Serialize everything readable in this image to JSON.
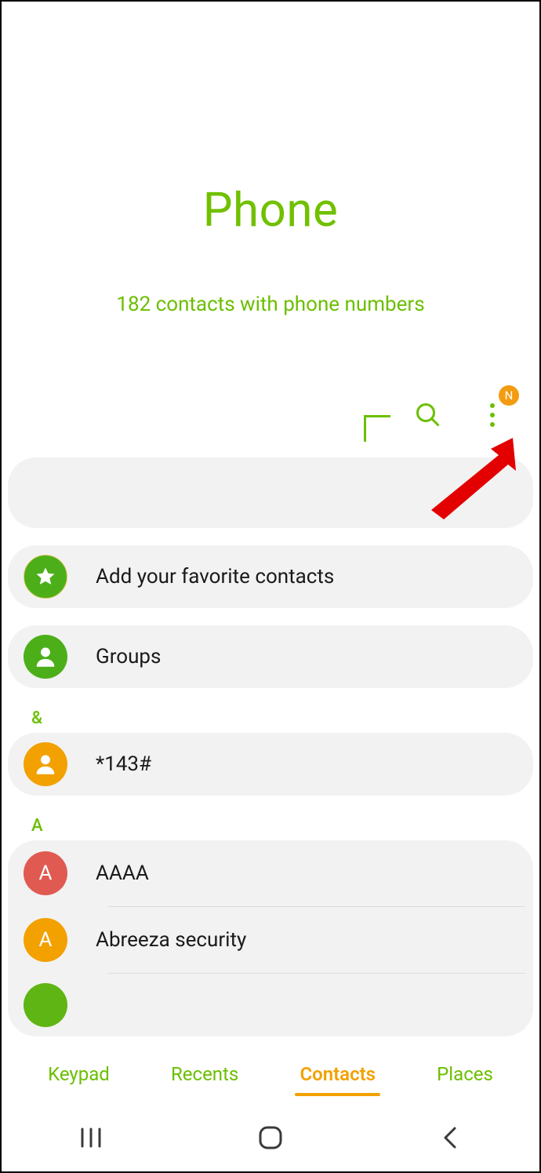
{
  "header": {
    "title": "Phone",
    "subtitle": "182 contacts with phone numbers"
  },
  "actions": {
    "badge_letter": "N"
  },
  "list": {
    "favorites_label": "Add your favorite contacts",
    "groups_label": "Groups",
    "section1": "&",
    "contact1": "*143#",
    "section2": "A",
    "contact2": "AAAA",
    "contact3": "Abreeza security",
    "initial_A": "A",
    "initial_A2": "A"
  },
  "nav": {
    "keypad": "Keypad",
    "recents": "Recents",
    "contacts": "Contacts",
    "places": "Places"
  }
}
